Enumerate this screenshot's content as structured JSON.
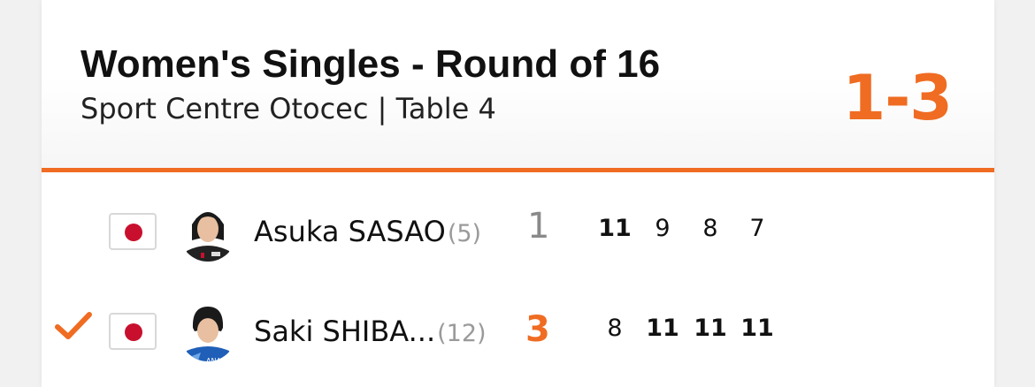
{
  "match": {
    "title": "Women's Singles - Round of 16",
    "subtitle": "Sport Centre Otocec | Table 4",
    "score": "1-3"
  },
  "colors": {
    "accent": "#ef6c22",
    "flag_red": "#c8102e"
  },
  "players": [
    {
      "name": "Asuka SASAO",
      "seed": "(5)",
      "games_won": "1",
      "winner": false,
      "flag": "japan-flag-icon",
      "sets": [
        "11",
        "9",
        "8",
        "7"
      ],
      "set_wins": [
        true,
        false,
        false,
        false
      ]
    },
    {
      "name": "Saki SHIBA...",
      "seed": "(12)",
      "games_won": "3",
      "winner": true,
      "flag": "japan-flag-icon",
      "sets": [
        "8",
        "11",
        "11",
        "11"
      ],
      "set_wins": [
        false,
        true,
        true,
        true
      ]
    }
  ]
}
